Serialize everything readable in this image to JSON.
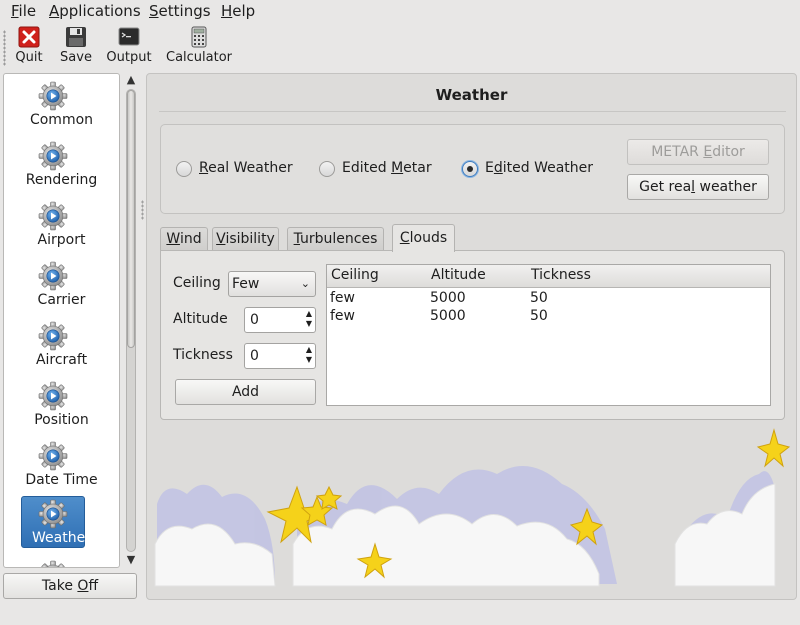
{
  "menubar": {
    "items": [
      {
        "id": "file",
        "label": "File",
        "u": "F",
        "rest": "ile"
      },
      {
        "id": "applications",
        "label": "Applications",
        "u": "A",
        "rest": "pplications"
      },
      {
        "id": "settings",
        "label": "Settings",
        "u": "S",
        "rest": "ettings"
      },
      {
        "id": "help",
        "label": "Help",
        "u": "H",
        "rest": "elp"
      }
    ]
  },
  "toolbar": {
    "quit": "Quit",
    "save": "Save",
    "output": "Output",
    "calculator": "Calculator"
  },
  "nav": {
    "items": [
      "Common",
      "Rendering",
      "Airport",
      "Carrier",
      "Aircraft",
      "Position",
      "Date Time",
      "Weather"
    ],
    "selected": "Weather",
    "accent": "#3a7bc0"
  },
  "takeoff": {
    "u_before": "Take ",
    "u": "O",
    "after": "ff",
    "label": "Take Off"
  },
  "weather": {
    "title": "Weather",
    "radios": {
      "real": {
        "u": "R",
        "rest": "eal Weather",
        "label": "Real Weather",
        "checked": false
      },
      "metar": {
        "before": "Edited ",
        "u": "M",
        "rest": "etar",
        "label": "Edited Metar",
        "checked": false
      },
      "edited": {
        "before": "E",
        "u": "d",
        "rest": "ited Weather",
        "label": "Edited Weather",
        "checked": true
      }
    },
    "metar_editor": {
      "before": "METAR ",
      "u": "E",
      "rest": "ditor",
      "label": "METAR Editor",
      "enabled": false
    },
    "get_real": {
      "before": "Get rea",
      "u": "l",
      "rest": " weather",
      "label": "Get real weather"
    },
    "tabs": [
      {
        "id": "wind",
        "u": "W",
        "rest": "ind",
        "label": "Wind"
      },
      {
        "id": "visibility",
        "u": "V",
        "rest": "isibility",
        "label": "Visibility"
      },
      {
        "id": "turbulences",
        "u": "T",
        "rest": "urbulences",
        "label": "Turbulences"
      },
      {
        "id": "clouds",
        "u": "C",
        "rest": "louds",
        "label": "Clouds"
      }
    ],
    "active_tab": "Clouds",
    "clouds": {
      "ceiling_label": "Ceiling",
      "ceiling_value": "Few",
      "altitude_label": "Altitude",
      "altitude_value": "0",
      "tickness_label": "Tickness",
      "tickness_value": "0",
      "add": "Add",
      "table": {
        "columns": [
          "Ceiling",
          "Altitude",
          "Tickness"
        ],
        "rows": [
          [
            "few",
            "5000",
            "50"
          ],
          [
            "few",
            "5000",
            "50"
          ]
        ]
      }
    }
  }
}
